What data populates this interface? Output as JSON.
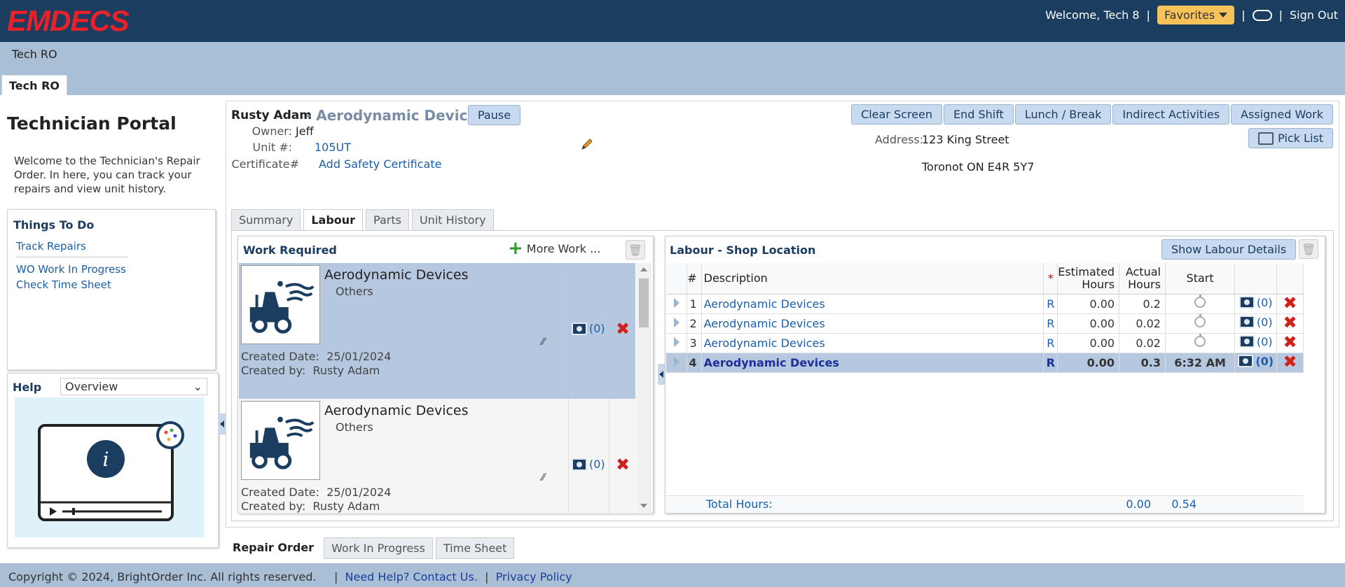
{
  "app": {
    "logo": "EMDECS",
    "welcome": "Welcome, Tech 8",
    "favorites": "Favorites",
    "sign_out": "Sign Out",
    "sep": "|"
  },
  "breadcrumb": "Tech RO",
  "main_tab": "Tech RO",
  "left": {
    "title": "Technician Portal",
    "desc": "Welcome to the Technician's Repair Order. In here, you can track your repairs and view unit history.",
    "todo": {
      "title": "Things To Do",
      "links": [
        "Track Repairs",
        "WO Work In Progress",
        "Check Time Sheet"
      ]
    },
    "help": {
      "label": "Help",
      "selected": "Overview"
    }
  },
  "ro": {
    "tech": "Rusty Adam",
    "sep": " - ",
    "desc": "Aerodynamic Devices",
    "pause": "Pause",
    "buttons": [
      "Clear Screen",
      "End Shift",
      "Lunch / Break",
      "Indirect Activities",
      "Assigned Work"
    ],
    "pick_list": "Pick List",
    "owner_label": "Owner:",
    "owner": "Jeff",
    "unit_label": "Unit #:",
    "unit": "105UT",
    "cert_label": "Certificate#",
    "cert_link": "Add Safety Certificate",
    "address_label": "Address:",
    "address1": "123 King Street",
    "address2": "Toronot ON E4R 5Y7",
    "tabs": [
      "Summary",
      "Labour",
      "Parts",
      "Unit History"
    ],
    "active_tab": "Labour"
  },
  "work_required": {
    "title": "Work Required",
    "more": "More Work ...",
    "items": [
      {
        "title": "Aerodynamic Devices",
        "sub": "Others",
        "created_date_label": "Created Date:",
        "created_date": "25/01/2024",
        "created_by_label": "Created by:",
        "created_by": "Rusty Adam",
        "photos": "(0)"
      },
      {
        "title": "Aerodynamic Devices",
        "sub": "Others",
        "created_date_label": "Created Date:",
        "created_date": "25/01/2024",
        "created_by_label": "Created by:",
        "created_by": "Rusty Adam",
        "photos": "(0)"
      }
    ]
  },
  "labour": {
    "title": "Labour - Shop Location",
    "show_details": "Show Labour Details",
    "headers": {
      "num": "#",
      "desc": "Description",
      "star": "*",
      "est": "Estimated Hours",
      "act": "Actual Hours",
      "start": "Start"
    },
    "rows": [
      {
        "num": "1",
        "desc": "Aerodynamic Devices",
        "code": "R",
        "est": "0.00",
        "act": "0.2",
        "start": "",
        "photos": "(0)"
      },
      {
        "num": "2",
        "desc": "Aerodynamic Devices",
        "code": "R",
        "est": "0.00",
        "act": "0.02",
        "start": "",
        "photos": "(0)"
      },
      {
        "num": "3",
        "desc": "Aerodynamic Devices",
        "code": "R",
        "est": "0.00",
        "act": "0.02",
        "start": "",
        "photos": "(0)"
      },
      {
        "num": "4",
        "desc": "Aerodynamic Devices",
        "code": "R",
        "est": "0.00",
        "act": "0.3",
        "start": "6:32 AM",
        "photos": "(0)"
      }
    ],
    "total_label": "Total Hours:",
    "total_est": "0.00",
    "total_act": "0.54"
  },
  "bottom_tabs": [
    "Repair Order",
    "Work In Progress",
    "Time Sheet"
  ],
  "footer": {
    "copyright": "Copyright © 2024, BrightOrder Inc. All rights reserved.",
    "help": "Need Help? Contact Us.",
    "privacy": "Privacy Policy",
    "sep": "|"
  }
}
